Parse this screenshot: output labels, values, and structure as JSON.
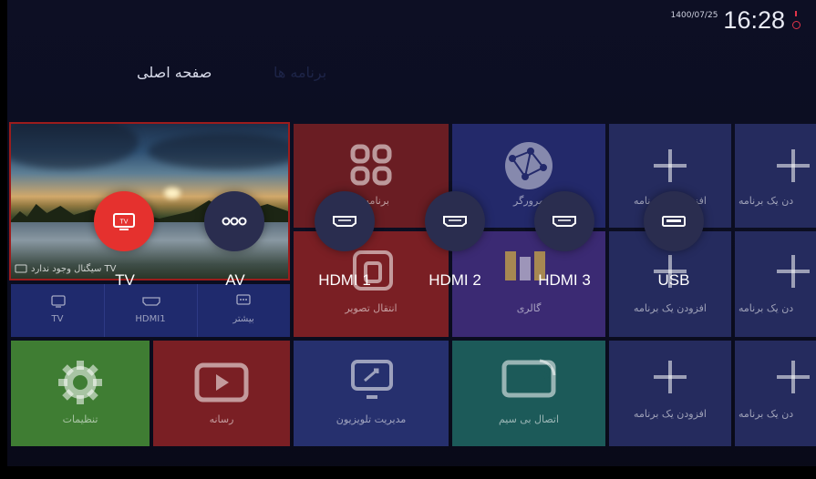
{
  "status": {
    "date": "1400/07/25",
    "time": "16:28"
  },
  "nav": {
    "home": "صفحه اصلی",
    "apps": "برنامه ها"
  },
  "tiles": {
    "apps_label": "برنامه ها",
    "browser_label": "مرورگر",
    "add_app": "افزودن یک برنامه",
    "add_app_cut": "دن یک برنامه",
    "screen_mirror": "انتقال تصویر",
    "gallery": "گالری",
    "settings": "تنظیمات",
    "media": "رسانه",
    "tv_manage": "مدیریت تلویزیون",
    "wireless": "اتصال بی سیم"
  },
  "preview": {
    "no_signal": "سیگنال وجود ندارد TV",
    "shortcuts": [
      {
        "icon": "tv-icon",
        "label": "TV"
      },
      {
        "icon": "hdmi-icon",
        "label": "HDMI1"
      },
      {
        "icon": "more-icon",
        "label": "بیشتر"
      }
    ]
  },
  "sources": [
    {
      "label": "TV",
      "icon": "tv-icon",
      "active": true
    },
    {
      "label": "AV",
      "icon": "av-icon",
      "active": false
    },
    {
      "label": "HDMI 1",
      "icon": "hdmi-icon",
      "active": false
    },
    {
      "label": "HDMI 2",
      "icon": "hdmi-icon",
      "active": false
    },
    {
      "label": "HDMI 3",
      "icon": "hdmi-icon",
      "active": false
    },
    {
      "label": "USB",
      "icon": "usb-icon",
      "active": false
    }
  ],
  "colors": {
    "active_source": "#e5312e",
    "tile_red": "#7a1f24",
    "tile_blue": "#252f78",
    "tile_purple": "#3d2a73",
    "tile_teal": "#1c5a59",
    "tile_green": "#3f7d33"
  }
}
